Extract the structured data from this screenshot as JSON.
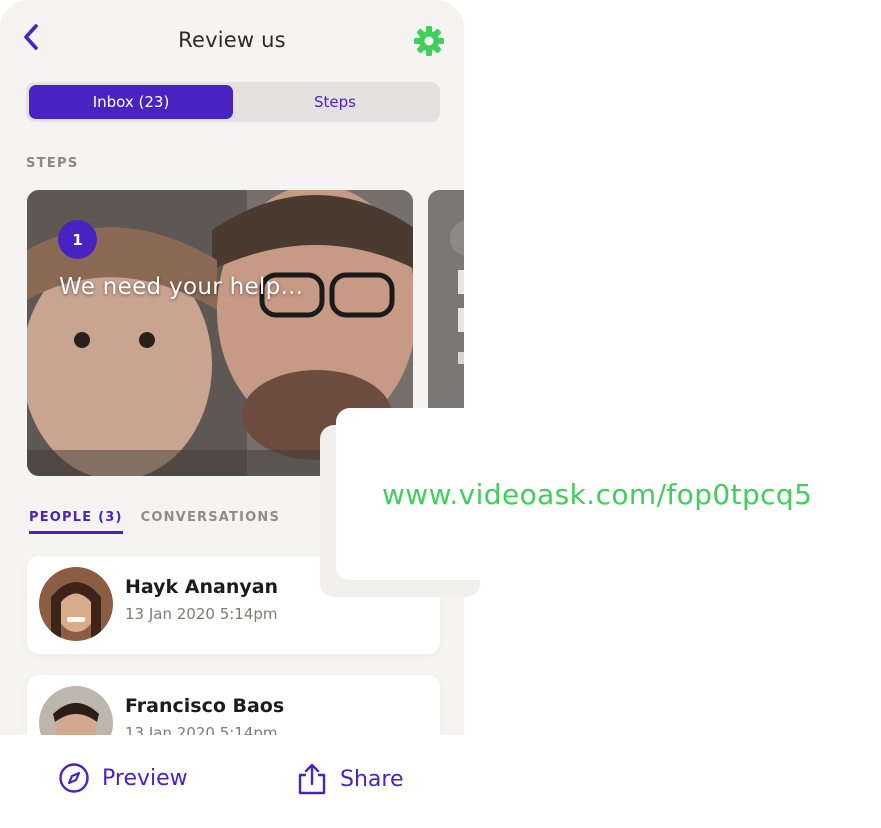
{
  "header": {
    "title": "Review us",
    "back_icon": "chevron-left-icon",
    "settings_icon": "gear-icon"
  },
  "segments": [
    {
      "label": "Inbox (23)",
      "active": true
    },
    {
      "label": "Steps",
      "active": false
    }
  ],
  "steps_section": {
    "label": "STEPS",
    "cards": [
      {
        "number": "1",
        "text": "We need your help..."
      }
    ]
  },
  "people_tabs": [
    {
      "label": "PEOPLE (3)",
      "active": true
    },
    {
      "label": "CONVERSATIONS",
      "active": false
    }
  ],
  "people": [
    {
      "name": "Hayk Ananyan",
      "date": "13 Jan 2020 5:14pm"
    },
    {
      "name": "Francisco Baos",
      "date": "13 Jan 2020 5:14pm"
    }
  ],
  "actions": {
    "preview_label": "Preview",
    "preview_icon": "compass-icon",
    "share_label": "Share",
    "share_icon": "share-icon"
  },
  "url_card": {
    "url": "www.videoask.com/fop0tpcq5"
  },
  "colors": {
    "accent": "#4b22c2",
    "green": "#3fcf5a",
    "background": "#f5f4f2"
  }
}
